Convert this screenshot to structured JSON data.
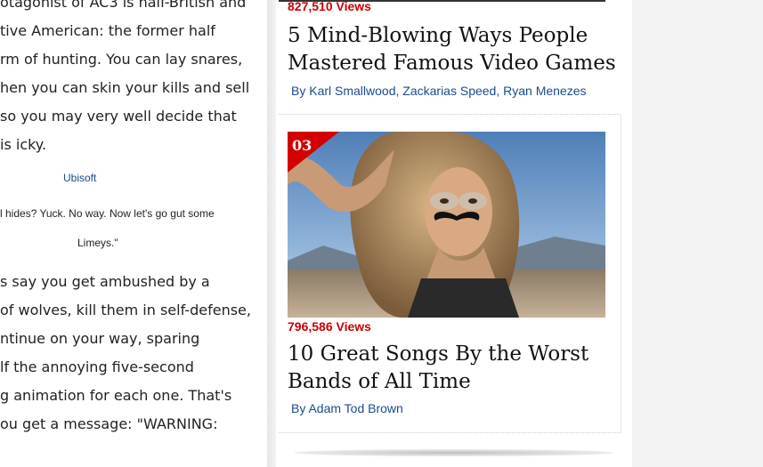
{
  "article": {
    "lines_top": [
      "otagonist of AC3 is half-British and",
      "tive American: the former half",
      "rm of hunting. You can lay snares,",
      "hen you can skin your kills and sell",
      " so you may very well decide that",
      " is icky."
    ],
    "credit": "Ubisoft",
    "quote_lines": [
      "l hides? Yuck. No way. Now let's go gut some",
      "Limeys.\""
    ],
    "lines_bottom": [
      "s say you get ambushed by a",
      " of wolves, kill them in self-defense,",
      "ntinue on your way, sparing",
      "lf the annoying five-second",
      "g animation for each one. That's",
      "ou get a message: \"WARNING:"
    ]
  },
  "sidebar": {
    "items": [
      {
        "views": "827,510 Views",
        "title": "5 Mind-Blowing Ways People Mastered Famous Video Games",
        "by": "By",
        "authors": [
          "Karl Smallwood",
          "Zackarias Speed",
          "Ryan Menezes"
        ]
      },
      {
        "rank": "03",
        "views": "796,586 Views",
        "title": "10 Great Songs By the Worst Bands of All Time",
        "by": "By",
        "authors": [
          "Adam Tod Brown"
        ]
      }
    ]
  },
  "colors": {
    "accent_red": "#d40000",
    "link_blue": "#1a4b8c"
  }
}
